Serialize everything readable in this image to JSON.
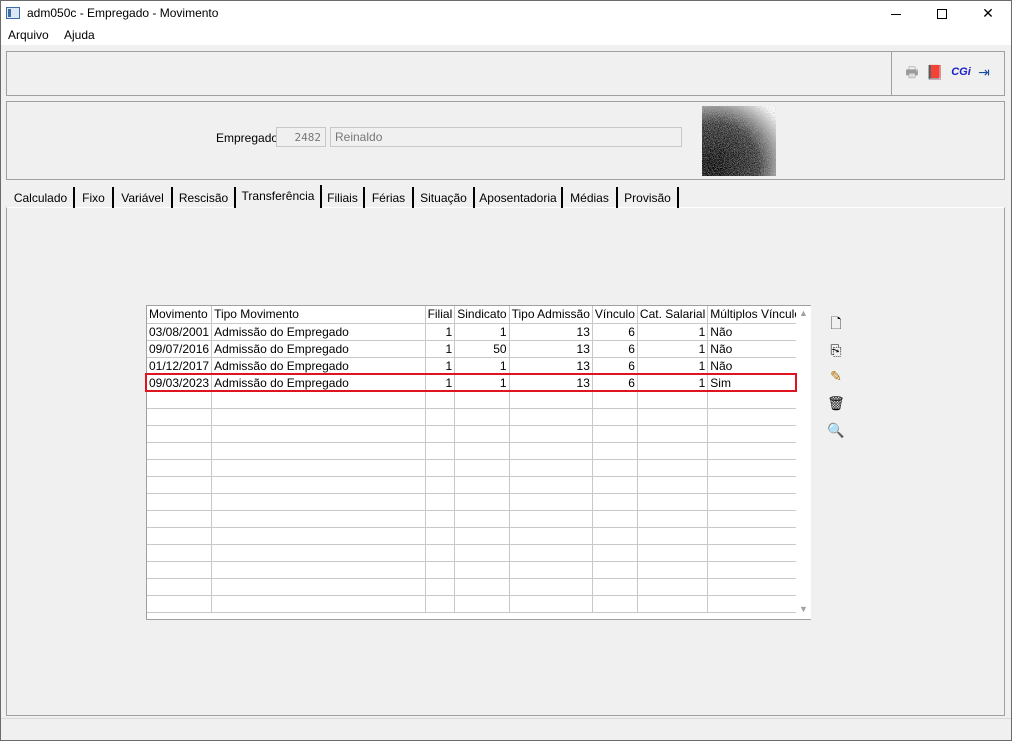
{
  "window": {
    "title": "adm050c - Empregado - Movimento",
    "min_glyph": "",
    "max_glyph": "",
    "close_glyph": "✕"
  },
  "menu": {
    "items": [
      "Arquivo",
      "Ajuda"
    ]
  },
  "toolbar": {
    "icons": [
      "printer-icon",
      "book-icon",
      "cgi-icon",
      "exit-icon"
    ],
    "cgi_label": "CGi",
    "print_glyph": "🖶",
    "book_glyph": "📕",
    "exit_glyph": "⇥"
  },
  "employee": {
    "label": "Empregado:",
    "code": "2482",
    "name": "Reinaldo"
  },
  "tabs": [
    {
      "label": "Calculado"
    },
    {
      "label": "Fixo"
    },
    {
      "label": "Variável"
    },
    {
      "label": "Rescisão"
    },
    {
      "label": "Transferência"
    },
    {
      "label": "Filiais"
    },
    {
      "label": "Férias"
    },
    {
      "label": "Situação"
    },
    {
      "label": "Aposentadoria"
    },
    {
      "label": "Médias"
    },
    {
      "label": "Provisão"
    }
  ],
  "active_tab": "Transferência",
  "grid": {
    "columns": [
      "Movimento",
      "Tipo Movimento",
      "Filial",
      "Sindicato",
      "Tipo Admissão",
      "Vínculo",
      "Cat. Salarial",
      "Múltiplos Vínculos"
    ],
    "rows": [
      [
        "03/08/2001",
        "Admissão do Empregado",
        "1",
        "1",
        "13",
        "6",
        "1",
        "Não"
      ],
      [
        "09/07/2016",
        "Admissão do Empregado",
        "1",
        "50",
        "13",
        "6",
        "1",
        "Não"
      ],
      [
        "01/12/2017",
        "Admissão do Empregado",
        "1",
        "1",
        "13",
        "6",
        "1",
        "Não"
      ],
      [
        "09/03/2023",
        "Admissão do Empregado",
        "1",
        "1",
        "13",
        "6",
        "1",
        "Sim"
      ]
    ],
    "highlighted_row": 3,
    "empty_rows": 13,
    "highlight_color": "#e0141e"
  },
  "side_buttons": [
    {
      "name": "new-record-button",
      "icon": "new-document-icon",
      "glyph": "🗋"
    },
    {
      "name": "copy-record-button",
      "icon": "copy-icon",
      "glyph": "⎘"
    },
    {
      "name": "edit-record-button",
      "icon": "edit-pencil-icon",
      "glyph": "✎"
    },
    {
      "name": "delete-record-button",
      "icon": "trash-icon",
      "glyph": "🗑"
    },
    {
      "name": "view-record-button",
      "icon": "magnifier-icon",
      "glyph": "🔍"
    }
  ]
}
